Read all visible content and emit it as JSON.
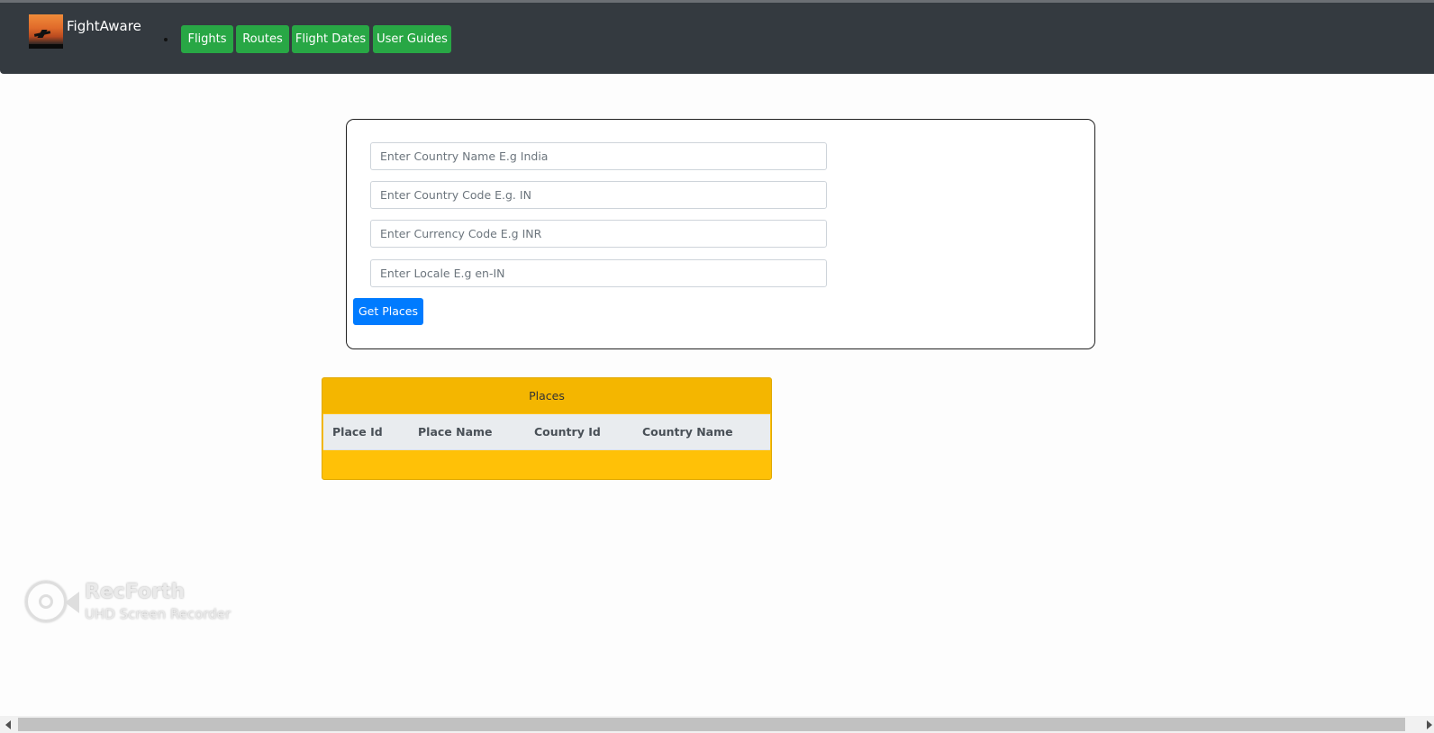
{
  "navbar": {
    "brand_name": "FightAware",
    "items": [
      {
        "label": "Flights"
      },
      {
        "label": "Routes"
      },
      {
        "label": "Flight Dates"
      },
      {
        "label": "User Guides"
      }
    ]
  },
  "form": {
    "country_name_placeholder": "Enter Country Name E.g India",
    "country_code_placeholder": "Enter Country Code E.g. IN",
    "currency_code_placeholder": "Enter Currency Code E.g INR",
    "locale_placeholder": "Enter Locale E.g en-IN",
    "submit_label": "Get Places"
  },
  "places": {
    "title": "Places",
    "columns": [
      "Place Id",
      "Place Name",
      "Country Id",
      "Country Name"
    ],
    "rows": []
  },
  "watermark": {
    "title": "RecForth",
    "subtitle": "UHD Screen Recorder"
  },
  "colors": {
    "navbar_bg": "#343a40",
    "nav_button": "#28a745",
    "primary_button": "#007bff",
    "places_card": "#ffc107"
  }
}
